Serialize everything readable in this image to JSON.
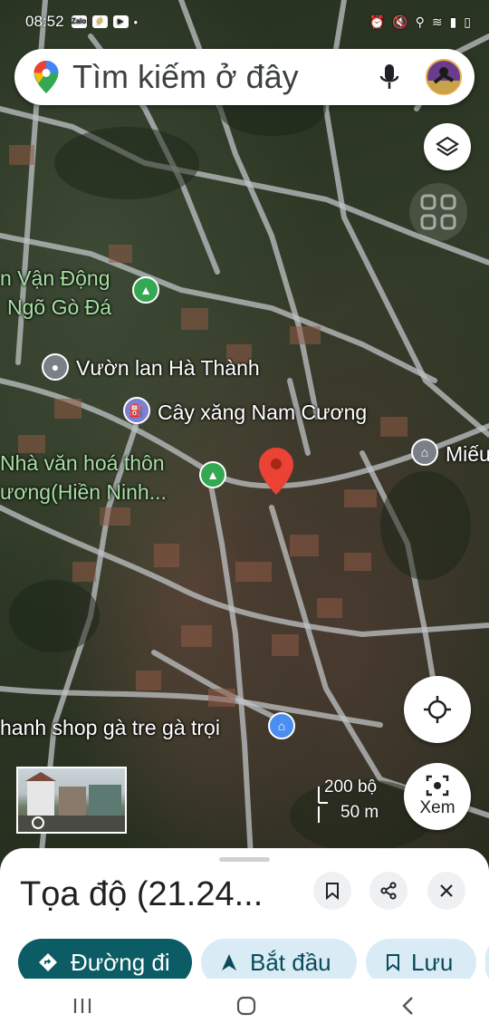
{
  "status_bar": {
    "time": "08:52",
    "app_icons": [
      "Zalo",
      "messenger-icon",
      "youtube-icon",
      "•"
    ],
    "right_icons": [
      "alarm-icon",
      "mute-icon",
      "location-icon",
      "wifi-icon",
      "signal-icon",
      "battery-icon"
    ]
  },
  "search": {
    "placeholder": "Tìm kiếm ở đây"
  },
  "map_labels": {
    "van_dong": "n Vận Động",
    "ngo_go_da": "Ngõ Gò Đá",
    "vuon_lan": "Vườn lan Hà Thành",
    "cay_xang": "Cây xăng Nam Cương",
    "mieu": "Miếu",
    "nha_van_hoa_1": "Nhà văn hoá thôn",
    "nha_van_hoa_2": "ương(Hiền Ninh...",
    "shop": "hanh shop gà tre gà trọi"
  },
  "scale": {
    "top": "200 bộ",
    "bottom": "50 m"
  },
  "buttons": {
    "xem": "Xem"
  },
  "sheet": {
    "title": "Tọa độ (21.24...",
    "directions": "Đường đi",
    "start": "Bắt đầu",
    "save": "Lưu"
  },
  "colors": {
    "directions_bg": "#0b5c65",
    "chip_bg": "#d9ecf5",
    "marker": "#ea4335",
    "park_poi": "#34a853",
    "gas_poi": "#7b7fd6"
  }
}
